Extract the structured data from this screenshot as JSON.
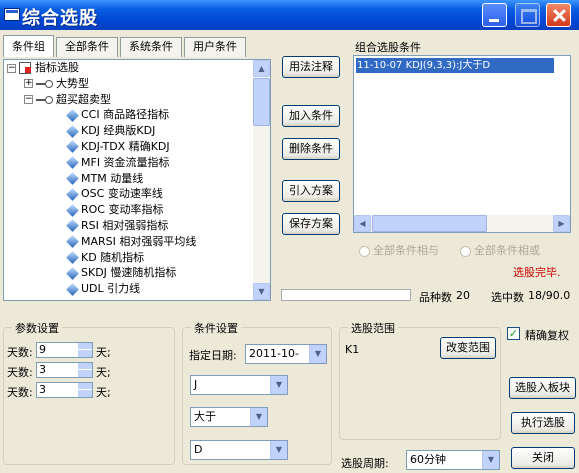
{
  "window": {
    "title": "综合选股"
  },
  "tabs": [
    "条件组",
    "全部条件",
    "系统条件",
    "用户条件"
  ],
  "tree": {
    "root": "指标选股",
    "groups": [
      "大势型",
      "超买超卖型"
    ],
    "items": [
      "CCI 商品路径指标",
      "KDJ 经典版KDJ",
      "KDJ-TDX 精确KDJ",
      "MFI 资金流量指标",
      "MTM 动量线",
      "OSC 变动速率线",
      "ROC 变动率指标",
      "RSI 相对强弱指标",
      "MARSI 相对强弱平均线",
      "KD 随机指标",
      "SKDJ 慢速随机指标",
      "UDL 引力线"
    ]
  },
  "buttons": {
    "usage": "用法注释",
    "add": "加入条件",
    "delete": "删除条件",
    "import": "引入方案",
    "save": "保存方案",
    "change_range": "改变范围",
    "to_block": "选股入板块",
    "execute": "执行选股",
    "close": "关闭"
  },
  "conditions": {
    "label": "组合选股条件",
    "items": [
      "11-10-07 KDJ(9,3,3):J大于D"
    ]
  },
  "logic": {
    "and": "全部条件相与",
    "or": "全部条件相或"
  },
  "status": {
    "done": "选股完毕.",
    "count_label": "品种数",
    "count_value": "20",
    "hits_label": "选中数",
    "hits_value": "18/90.0"
  },
  "params": {
    "title": "参数设置",
    "rows": [
      {
        "label": "天数:",
        "value": "9",
        "unit": "天;"
      },
      {
        "label": "天数:",
        "value": "3",
        "unit": "天;"
      },
      {
        "label": "天数:",
        "value": "3",
        "unit": "天;"
      }
    ]
  },
  "condition_settings": {
    "title": "条件设置",
    "date_label": "指定日期:",
    "date_value": "2011-10-",
    "left": "J",
    "operator": "大于",
    "right": "D"
  },
  "scope": {
    "title": "选股范围",
    "value": "K1"
  },
  "precise_restore": {
    "label": "精确复权",
    "checked": true
  },
  "period": {
    "label": "选股周期:",
    "value": "60分钟"
  }
}
